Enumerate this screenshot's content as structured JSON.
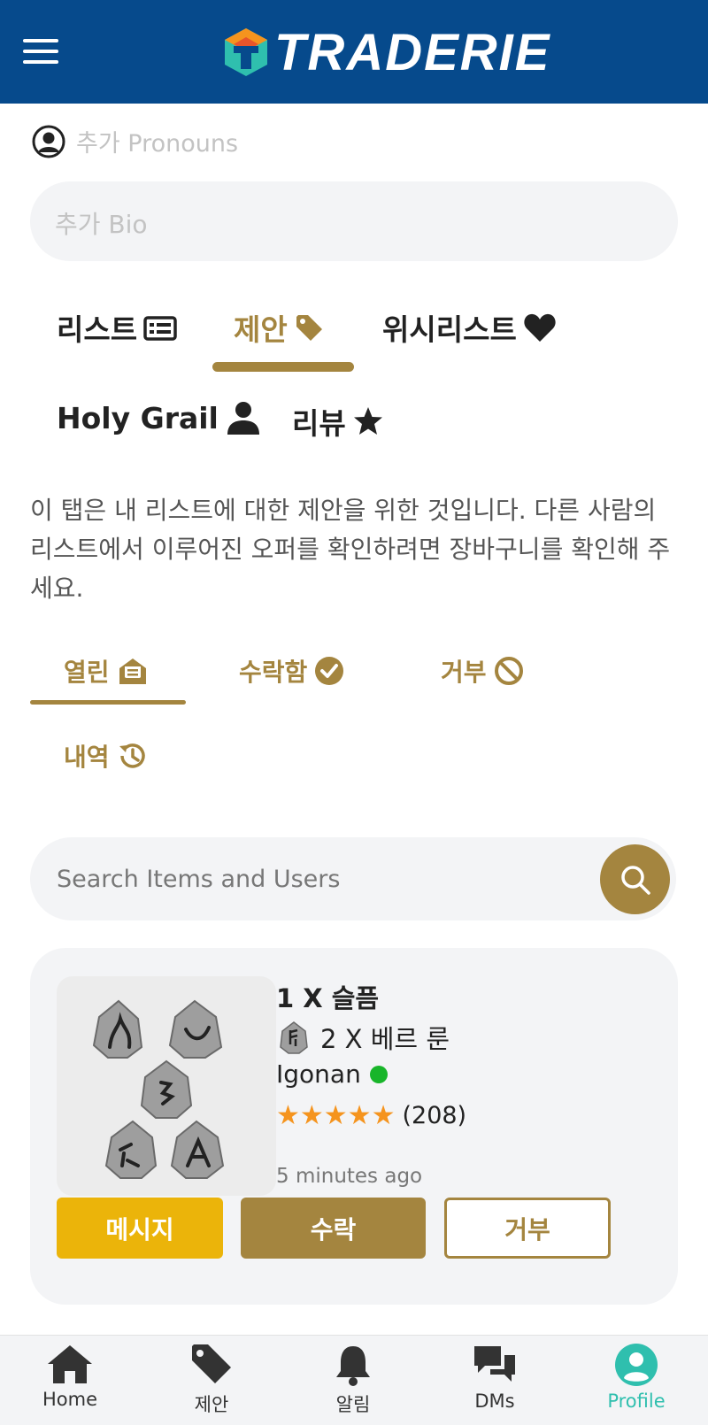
{
  "header": {
    "logo_text": "TRADERIE"
  },
  "profile": {
    "pronouns_placeholder": "추가 Pronouns",
    "bio_placeholder": "추가 Bio"
  },
  "main_tabs": {
    "listings": "리스트",
    "offers": "제안",
    "wishlist": "위시리스트",
    "holy_grail": "Holy Grail",
    "reviews": "리뷰",
    "active": "offers"
  },
  "description": "이 탭은 내 리스트에 대한 제안을 위한 것입니다. 다른 사람의 리스트에서 이루어진 오퍼를 확인하려면 장바구니를 확인해 주세요.",
  "sub_tabs": {
    "open": "열린",
    "accepted": "수락함",
    "declined": "거부",
    "history": "내역",
    "active": "open"
  },
  "search": {
    "placeholder": "Search Items and Users"
  },
  "offer": {
    "title": "1 X 슬픔",
    "sub": "2 X 베르 룬",
    "user": "Igonan",
    "rating_stars": "★★★★★",
    "rating_count": "(208)",
    "time": "5 minutes ago",
    "message_btn": "메시지",
    "accept_btn": "수락",
    "decline_btn": "거부"
  },
  "bottom_nav": {
    "home": "Home",
    "offers": "제안",
    "notifications": "알림",
    "dms": "DMs",
    "profile": "Profile",
    "active": "profile"
  },
  "colors": {
    "header": "#064a8c",
    "accent": "#a4853f",
    "message": "#ebb40a",
    "active_nav": "#2fbfae",
    "online": "#18b52a",
    "star": "#f5941e"
  }
}
